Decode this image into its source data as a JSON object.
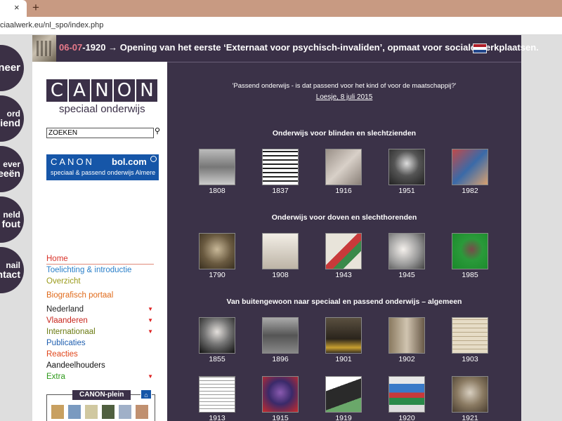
{
  "browser": {
    "tab_close": "×",
    "new_tab": "+",
    "url": "ciaalwerk.eu/nl_spo/index.php"
  },
  "side_buttons": [
    {
      "line1": "",
      "line2": "neer"
    },
    {
      "line1": "ord",
      "line2": "iend"
    },
    {
      "line1": "ever",
      "line2": "eeën"
    },
    {
      "line1": "neld",
      "line2": "n fout"
    },
    {
      "line1": "nail",
      "line2": "ntact"
    }
  ],
  "headline": {
    "date": "06-07",
    "rest": "-1920 → Opening van het eerste ‘Externaat voor psychisch-invaliden’, opmaat voor sociale werkplaatsen.",
    "flag_colors": [
      "#ae1c28",
      "#ffffff",
      "#21468b"
    ]
  },
  "logo": {
    "letters": [
      "C",
      "A",
      "N",
      "O",
      "N"
    ],
    "subtitle": "speciaal onderwijs"
  },
  "search": {
    "value": "ZOEKEN",
    "button": "⚲"
  },
  "banner": {
    "left": "CANON",
    "right": "bol.com",
    "sub": "speciaal & passend onderwijs Almere"
  },
  "menu": {
    "home": "Home",
    "toelichting": "Toelichting & introductie",
    "overzicht": "Overzicht",
    "biografisch": "Biografisch portaal",
    "nederland": "Nederland",
    "vlaanderen": "Vlaanderen",
    "internationaal": "Internationaal",
    "publicaties": "Publicaties",
    "reacties": "Reacties",
    "aandeelhouders": "Aandeelhouders",
    "extra": "Extra",
    "arrow": "▼"
  },
  "plein": {
    "title": "CANON-plein",
    "home_icon": "⌂"
  },
  "quote": {
    "text": "'Passend onderwijs - is dat passend voor het kind of voor de maatschappij?'",
    "source": "Loesje, 8 juli 2015"
  },
  "sections": [
    {
      "title": "Onderwijs voor blinden en slechtzienden",
      "years": [
        "1808",
        "1837",
        "1916",
        "1951",
        "1982"
      ]
    },
    {
      "title": "Onderwijs voor doven en slechthorenden",
      "years": [
        "1790",
        "1908",
        "1943",
        "1945",
        "1985"
      ]
    },
    {
      "title": "Van buitengewoon naar speciaal en passend onderwijs – algemeen",
      "years": [
        "1855",
        "1896",
        "1901",
        "1902",
        "1903"
      ]
    },
    {
      "title": "",
      "years": [
        "1913",
        "1915",
        "1919",
        "1920",
        "1921"
      ]
    }
  ]
}
